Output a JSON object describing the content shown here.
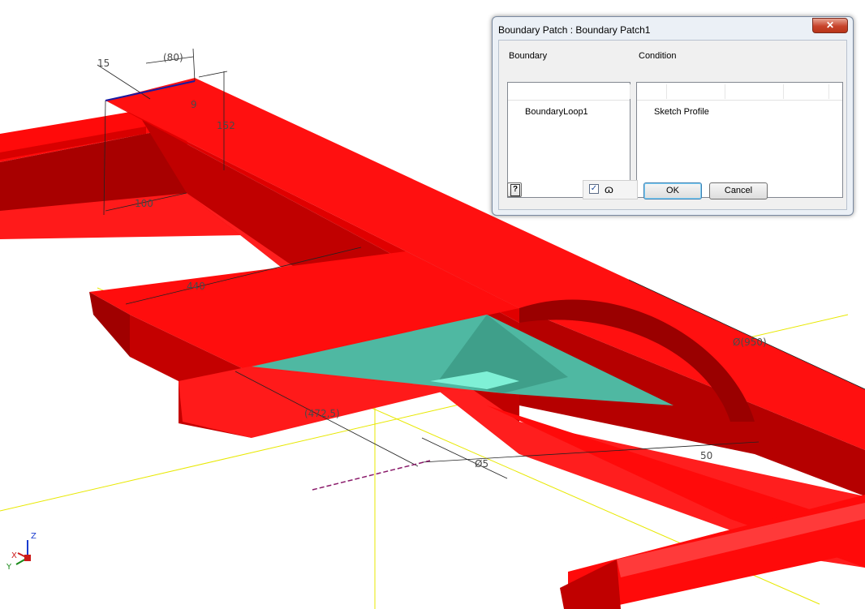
{
  "dialog": {
    "title": "Boundary Patch : Boundary Patch1",
    "close_icon": "close-x-icon",
    "boundary_header": "Boundary",
    "condition_header": "Condition",
    "boundary_items": [
      "BoundaryLoop1"
    ],
    "condition_items": [
      "Sketch Profile"
    ],
    "preview_checked": true,
    "help_icon": "help-icon",
    "preview_icon": "glasses-icon",
    "ok_label": "OK",
    "cancel_label": "Cancel"
  },
  "dimensions": {
    "d15": "15",
    "d80": "(80)",
    "d9": "9",
    "d152": "152",
    "d100": "100",
    "d440": "440",
    "d950": "Ø(950)",
    "d4725": "(472,5)",
    "d5": "Ø5",
    "d50": "50"
  },
  "triad": {
    "z": "Z",
    "x": "X",
    "y": "Y"
  },
  "colors": {
    "beam": "#ff0000",
    "beam_shade": "#b00000",
    "patch": "#4fc7ad",
    "axis": "#f2f200",
    "z_axis": "#1a3ccf"
  }
}
